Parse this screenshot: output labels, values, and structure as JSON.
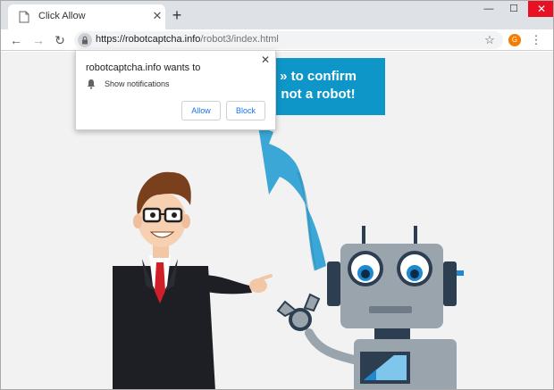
{
  "tab": {
    "title": "Click Allow"
  },
  "toolbar": {
    "url_host": "https://robotcaptcha.info",
    "url_path": "/robot3/index.html",
    "profile_initial": "G"
  },
  "banner": {
    "line1": "» to confirm",
    "line2": "not a robot!"
  },
  "popup": {
    "title": "robotcaptcha.info wants to",
    "permission": "Show notifications",
    "allow_label": "Allow",
    "block_label": "Block"
  },
  "colors": {
    "banner": "#0e96c9",
    "arrow": "#3aa7d6",
    "robot_body": "#9aa4ad",
    "suit": "#1e1f24",
    "tie": "#d11f2a",
    "page_bg": "#f2f2f2",
    "close_btn": "#e81123"
  }
}
